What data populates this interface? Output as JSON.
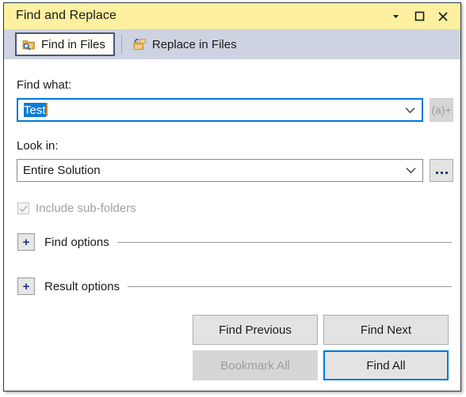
{
  "window": {
    "title": "Find and Replace",
    "title_buttons": [
      {
        "name": "pin-dropdown-icon",
        "glyph": "chevron-down"
      },
      {
        "name": "maximize-icon",
        "glyph": "square"
      },
      {
        "name": "close-icon",
        "glyph": "cross"
      }
    ],
    "colors": {
      "titlebar": "#fdf0a0",
      "tabstrip": "#ced3e1",
      "accent": "#0078d7",
      "selection": "#0c7cd5",
      "caret": "#d2833c",
      "expander_plus": "#1f2f8f",
      "folder_icon": "#e8b059",
      "disabled_text": "#9d9d9d"
    }
  },
  "tabs": [
    {
      "label": "Find in Files",
      "icon": "find-in-files-icon",
      "active": true
    },
    {
      "label": "Replace in Files",
      "icon": "replace-in-files-icon",
      "active": false
    }
  ],
  "find": {
    "label": "Find what:",
    "value": "Test",
    "value_selected": true,
    "placeholder": "",
    "dropdown_icon": "chevron-down-icon",
    "regex_builder_label": "(a)+",
    "regex_builder_enabled": false
  },
  "look_in": {
    "label": "Look in:",
    "value": "Entire Solution",
    "placeholder": "",
    "dropdown_icon": "chevron-down-icon",
    "browse_label": "...",
    "browse_enabled": true,
    "options": [
      "Entire Solution"
    ]
  },
  "include_subfolders": {
    "label": "Include sub-folders",
    "checked": true,
    "enabled": false
  },
  "sections": [
    {
      "label": "Find options",
      "expander": "+",
      "expanded": false
    },
    {
      "label": "Result options",
      "expander": "+",
      "expanded": false
    }
  ],
  "buttons": {
    "find_previous": {
      "label": "Find Previous",
      "state": "normal"
    },
    "find_next": {
      "label": "Find Next",
      "state": "normal"
    },
    "bookmark_all": {
      "label": "Bookmark All",
      "state": "disabled"
    },
    "find_all": {
      "label": "Find All",
      "state": "default"
    }
  }
}
